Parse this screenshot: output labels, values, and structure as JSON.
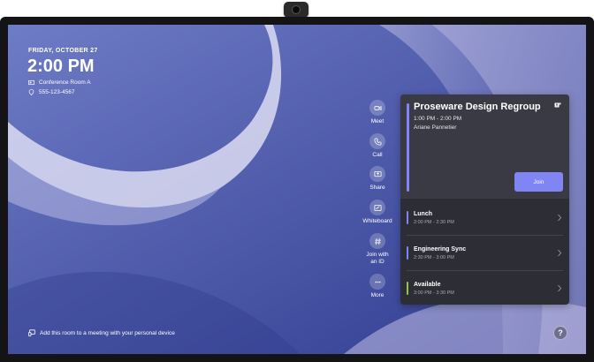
{
  "device": {
    "camera_icon": "camera-icon"
  },
  "clock": {
    "date": "FRIDAY, OCTOBER 27",
    "time": "2:00 PM"
  },
  "room": {
    "name": "Conference Room A",
    "phone": "555-123-4567",
    "room_icon": "room-icon",
    "phone_icon": "location-pin-icon"
  },
  "actions": [
    {
      "label": "Meet",
      "icon": "video-icon"
    },
    {
      "label": "Call",
      "icon": "phone-icon"
    },
    {
      "label": "Share",
      "icon": "share-screen-icon"
    },
    {
      "label": "Whiteboard",
      "icon": "whiteboard-icon"
    },
    {
      "label": "Join with\nan ID",
      "icon": "hash-icon"
    },
    {
      "label": "More",
      "icon": "more-icon"
    }
  ],
  "featured": {
    "title": "Proseware Design Regroup",
    "time": "1:00 PM - 2:00 PM",
    "organizer": "Ariane Pannetier",
    "join_label": "Join",
    "teams_icon": "teams-icon",
    "accent": "#7f85f5"
  },
  "meetings": [
    {
      "title": "Lunch",
      "time": "2:00 PM - 2:30 PM",
      "color": "#7f85f5"
    },
    {
      "title": "Engineering Sync",
      "time": "2:30 PM - 3:00 PM",
      "color": "#7f85f5"
    },
    {
      "title": "Available",
      "time": "3:00 PM - 3:30 PM",
      "color": "#92c353"
    }
  ],
  "footer": {
    "add_room_text": "Add this room to a meeting with your personal device",
    "help_label": "?"
  }
}
